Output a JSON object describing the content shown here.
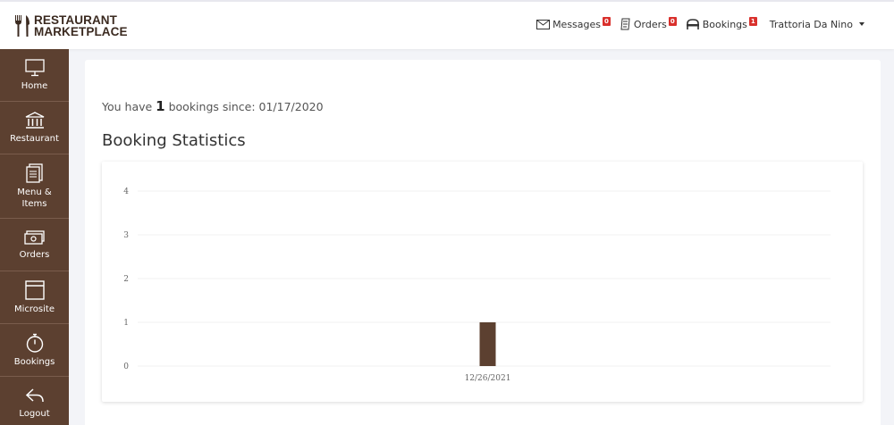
{
  "header": {
    "logo_line1": "RESTAURANT",
    "logo_line2": "MARKETPLACE",
    "nav": [
      {
        "label": "Messages",
        "badge": "0",
        "icon": "envelope-icon"
      },
      {
        "label": "Orders",
        "badge": "0",
        "icon": "receipt-icon"
      },
      {
        "label": "Bookings",
        "badge": "1",
        "icon": "booth-icon"
      }
    ],
    "user": "Trattoria Da Nino"
  },
  "sidebar": {
    "items": [
      {
        "label": "Home",
        "icon": "monitor-icon"
      },
      {
        "label": "Restaurant",
        "icon": "building-icon"
      },
      {
        "label": "Menu &\nItems",
        "icon": "menu-icon"
      },
      {
        "label": "Orders",
        "icon": "cash-icon"
      },
      {
        "label": "Microsite",
        "icon": "window-icon"
      },
      {
        "label": "Bookings",
        "icon": "stopwatch-icon"
      },
      {
        "label": "Logout",
        "icon": "logout-icon"
      }
    ]
  },
  "main": {
    "since_prefix": "You have ",
    "since_count": "1",
    "since_suffix": " bookings since: 01/17/2020",
    "title": "Booking Statistics"
  },
  "colors": {
    "sidebar_bg": "#5c4030",
    "bar": "#5c4030",
    "badge": "#d9302c"
  },
  "chart_data": {
    "type": "bar",
    "categories": [
      "12/26/2021"
    ],
    "values": [
      1
    ],
    "ylim": [
      0,
      4
    ],
    "yticks": [
      0,
      1,
      2,
      3,
      4
    ],
    "grid": true,
    "title": "",
    "xlabel": "",
    "ylabel": ""
  }
}
